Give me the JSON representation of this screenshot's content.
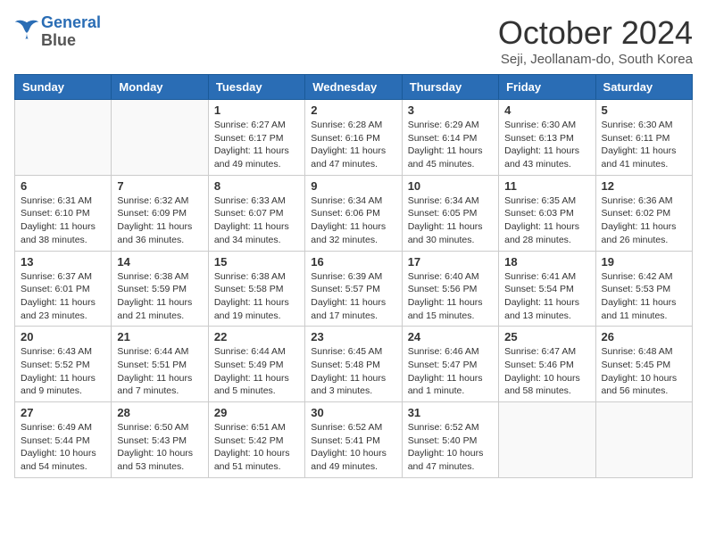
{
  "logo": {
    "line1": "General",
    "line2": "Blue"
  },
  "title": "October 2024",
  "subtitle": "Seji, Jeollanam-do, South Korea",
  "days_of_week": [
    "Sunday",
    "Monday",
    "Tuesday",
    "Wednesday",
    "Thursday",
    "Friday",
    "Saturday"
  ],
  "weeks": [
    [
      {
        "day": "",
        "info": ""
      },
      {
        "day": "",
        "info": ""
      },
      {
        "day": "1",
        "info": "Sunrise: 6:27 AM\nSunset: 6:17 PM\nDaylight: 11 hours and 49 minutes."
      },
      {
        "day": "2",
        "info": "Sunrise: 6:28 AM\nSunset: 6:16 PM\nDaylight: 11 hours and 47 minutes."
      },
      {
        "day": "3",
        "info": "Sunrise: 6:29 AM\nSunset: 6:14 PM\nDaylight: 11 hours and 45 minutes."
      },
      {
        "day": "4",
        "info": "Sunrise: 6:30 AM\nSunset: 6:13 PM\nDaylight: 11 hours and 43 minutes."
      },
      {
        "day": "5",
        "info": "Sunrise: 6:30 AM\nSunset: 6:11 PM\nDaylight: 11 hours and 41 minutes."
      }
    ],
    [
      {
        "day": "6",
        "info": "Sunrise: 6:31 AM\nSunset: 6:10 PM\nDaylight: 11 hours and 38 minutes."
      },
      {
        "day": "7",
        "info": "Sunrise: 6:32 AM\nSunset: 6:09 PM\nDaylight: 11 hours and 36 minutes."
      },
      {
        "day": "8",
        "info": "Sunrise: 6:33 AM\nSunset: 6:07 PM\nDaylight: 11 hours and 34 minutes."
      },
      {
        "day": "9",
        "info": "Sunrise: 6:34 AM\nSunset: 6:06 PM\nDaylight: 11 hours and 32 minutes."
      },
      {
        "day": "10",
        "info": "Sunrise: 6:34 AM\nSunset: 6:05 PM\nDaylight: 11 hours and 30 minutes."
      },
      {
        "day": "11",
        "info": "Sunrise: 6:35 AM\nSunset: 6:03 PM\nDaylight: 11 hours and 28 minutes."
      },
      {
        "day": "12",
        "info": "Sunrise: 6:36 AM\nSunset: 6:02 PM\nDaylight: 11 hours and 26 minutes."
      }
    ],
    [
      {
        "day": "13",
        "info": "Sunrise: 6:37 AM\nSunset: 6:01 PM\nDaylight: 11 hours and 23 minutes."
      },
      {
        "day": "14",
        "info": "Sunrise: 6:38 AM\nSunset: 5:59 PM\nDaylight: 11 hours and 21 minutes."
      },
      {
        "day": "15",
        "info": "Sunrise: 6:38 AM\nSunset: 5:58 PM\nDaylight: 11 hours and 19 minutes."
      },
      {
        "day": "16",
        "info": "Sunrise: 6:39 AM\nSunset: 5:57 PM\nDaylight: 11 hours and 17 minutes."
      },
      {
        "day": "17",
        "info": "Sunrise: 6:40 AM\nSunset: 5:56 PM\nDaylight: 11 hours and 15 minutes."
      },
      {
        "day": "18",
        "info": "Sunrise: 6:41 AM\nSunset: 5:54 PM\nDaylight: 11 hours and 13 minutes."
      },
      {
        "day": "19",
        "info": "Sunrise: 6:42 AM\nSunset: 5:53 PM\nDaylight: 11 hours and 11 minutes."
      }
    ],
    [
      {
        "day": "20",
        "info": "Sunrise: 6:43 AM\nSunset: 5:52 PM\nDaylight: 11 hours and 9 minutes."
      },
      {
        "day": "21",
        "info": "Sunrise: 6:44 AM\nSunset: 5:51 PM\nDaylight: 11 hours and 7 minutes."
      },
      {
        "day": "22",
        "info": "Sunrise: 6:44 AM\nSunset: 5:49 PM\nDaylight: 11 hours and 5 minutes."
      },
      {
        "day": "23",
        "info": "Sunrise: 6:45 AM\nSunset: 5:48 PM\nDaylight: 11 hours and 3 minutes."
      },
      {
        "day": "24",
        "info": "Sunrise: 6:46 AM\nSunset: 5:47 PM\nDaylight: 11 hours and 1 minute."
      },
      {
        "day": "25",
        "info": "Sunrise: 6:47 AM\nSunset: 5:46 PM\nDaylight: 10 hours and 58 minutes."
      },
      {
        "day": "26",
        "info": "Sunrise: 6:48 AM\nSunset: 5:45 PM\nDaylight: 10 hours and 56 minutes."
      }
    ],
    [
      {
        "day": "27",
        "info": "Sunrise: 6:49 AM\nSunset: 5:44 PM\nDaylight: 10 hours and 54 minutes."
      },
      {
        "day": "28",
        "info": "Sunrise: 6:50 AM\nSunset: 5:43 PM\nDaylight: 10 hours and 53 minutes."
      },
      {
        "day": "29",
        "info": "Sunrise: 6:51 AM\nSunset: 5:42 PM\nDaylight: 10 hours and 51 minutes."
      },
      {
        "day": "30",
        "info": "Sunrise: 6:52 AM\nSunset: 5:41 PM\nDaylight: 10 hours and 49 minutes."
      },
      {
        "day": "31",
        "info": "Sunrise: 6:52 AM\nSunset: 5:40 PM\nDaylight: 10 hours and 47 minutes."
      },
      {
        "day": "",
        "info": ""
      },
      {
        "day": "",
        "info": ""
      }
    ]
  ]
}
